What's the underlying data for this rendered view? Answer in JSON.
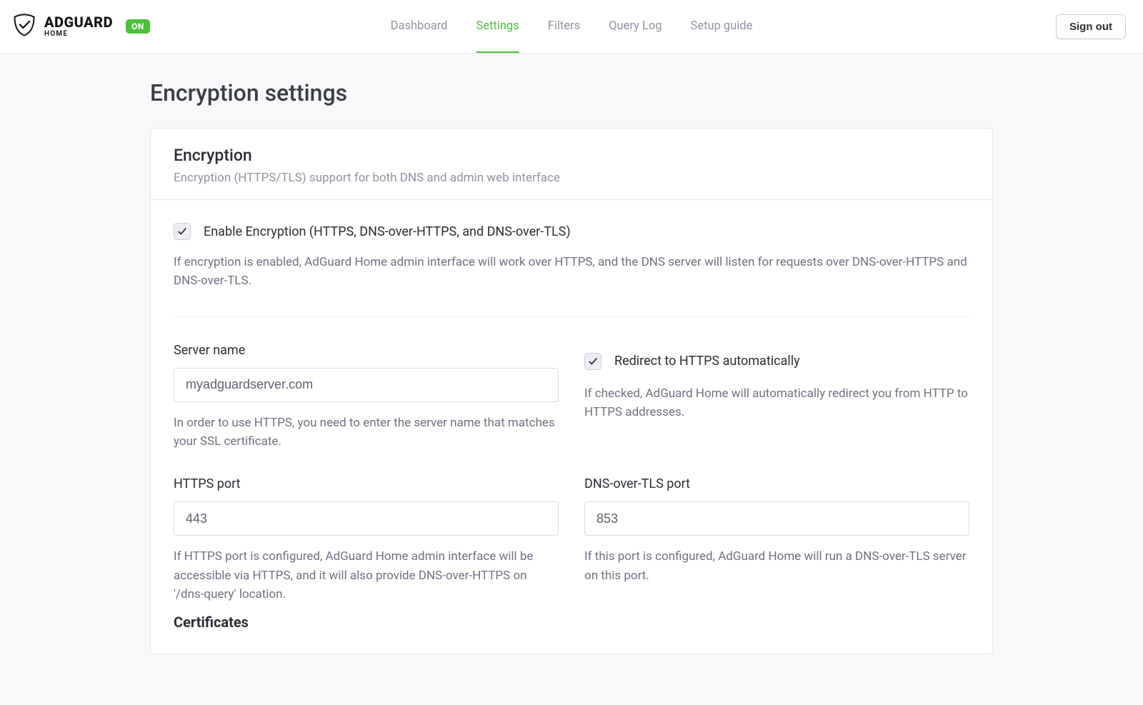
{
  "header": {
    "brand": "ADGUARD",
    "brand_sub": "HOME",
    "status": "ON",
    "nav": {
      "dashboard": "Dashboard",
      "settings": "Settings",
      "filters": "Filters",
      "querylog": "Query Log",
      "setupguide": "Setup guide"
    },
    "signout": "Sign out"
  },
  "page": {
    "title": "Encryption settings",
    "card_title": "Encryption",
    "card_subtitle": "Encryption (HTTPS/TLS) support for both DNS and admin web interface",
    "enable_label": "Enable Encryption (HTTPS, DNS-over-HTTPS, and DNS-over-TLS)",
    "enable_help": "If encryption is enabled, AdGuard Home admin interface will work over HTTPS, and the DNS server will listen for requests over DNS-over-HTTPS and DNS-over-TLS.",
    "server_name": {
      "label": "Server name",
      "value": "myadguardserver.com",
      "help": "In order to use HTTPS, you need to enter the server name that matches your SSL certificate."
    },
    "redirect": {
      "label": "Redirect to HTTPS automatically",
      "help": "If checked, AdGuard Home will automatically redirect you from HTTP to HTTPS addresses."
    },
    "https_port": {
      "label": "HTTPS port",
      "value": "443",
      "help": "If HTTPS port is configured, AdGuard Home admin interface will be accessible via HTTPS, and it will also provide DNS-over-HTTPS on '/dns-query' location."
    },
    "dot_port": {
      "label": "DNS-over-TLS port",
      "value": "853",
      "help": "If this port is configured, AdGuard Home will run a DNS-over-TLS server on this port."
    },
    "certificates_title": "Certificates"
  }
}
